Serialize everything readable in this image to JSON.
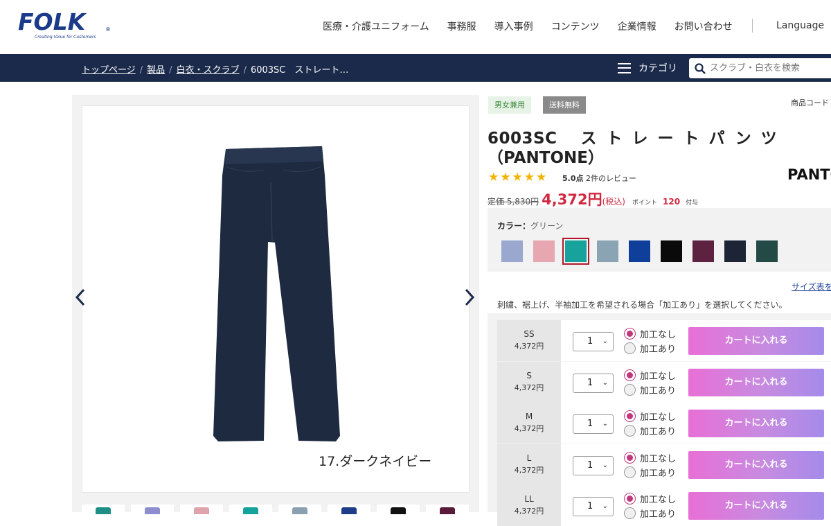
{
  "header": {
    "logo_text": "FOLK",
    "logo_tagline": "Creating Value for Customers",
    "nav": [
      "医療・介護ユニフォーム",
      "事務服",
      "導入事例",
      "コンテンツ",
      "企業情報",
      "お問い合わせ"
    ],
    "language_label": "Language"
  },
  "breadcrumb": {
    "items": [
      "トップページ",
      "製品",
      "白衣・スクラブ"
    ],
    "current": "6003SC　ストレート…"
  },
  "category_label": "カテゴリ",
  "search": {
    "placeholder": "スクラブ・白衣を検索"
  },
  "gallery": {
    "caption": "17.ダークネイビー",
    "thumb_colors": [
      "#1f8f86",
      "#8e8ecf",
      "#e0a2ab",
      "#14a39c",
      "#8aa0b0",
      "#1d3d8a",
      "#111111",
      "#5a1a3a"
    ]
  },
  "product": {
    "tags": [
      "男女兼用",
      "送料無料"
    ],
    "code_label": "商品コード",
    "title_code": "6003SC",
    "title_name": "ストレートパンツ",
    "title_line2": "（PANTONE）",
    "brand": "PANTO",
    "rating_value": "5.0点",
    "review_count": "2件のレビュー",
    "list_price": "定価 5,830円",
    "price": "4,372円",
    "tax": "(税込)",
    "point_label": "ポイント",
    "point_value": "120",
    "point_suffix": "付与",
    "color_label": "カラー：",
    "color_value": "グリーン",
    "colors": [
      "#9aa8cf",
      "#e7a7b1",
      "#17a39b",
      "#8aa4b3",
      "#0f3f9a",
      "#0a0a0a",
      "#5c2240",
      "#1c2436",
      "#244a45"
    ],
    "selected_color_index": 2,
    "size_chart_link": "サイズ表を",
    "note": "刺繍、裾上げ、半袖加工を希望される場合「加工あり」を選択してください。",
    "sizes": [
      {
        "size": "SS",
        "price": "4,372円",
        "qty": "1"
      },
      {
        "size": "S",
        "price": "4,372円",
        "qty": "1"
      },
      {
        "size": "M",
        "price": "4,372円",
        "qty": "1"
      },
      {
        "size": "L",
        "price": "4,372円",
        "qty": "1"
      },
      {
        "size": "LL",
        "price": "4,372円",
        "qty": "1"
      }
    ],
    "option_none": "加工なし",
    "option_with": "加工あり",
    "cart_button": "カートに入れる"
  }
}
